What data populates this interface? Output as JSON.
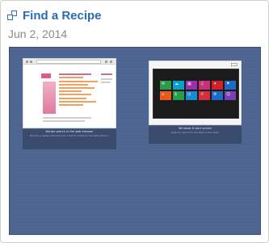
{
  "header": {
    "title": "Find a Recipe",
    "icon": "restore-windows-icon",
    "date": "Jun 2, 2014"
  },
  "stage": {
    "color_background": "#4e6490",
    "windows": [
      {
        "name": "browser-window",
        "caption_title": "Recipe search in the web browser",
        "caption_desc": "Browse a recipe site and pick a dish to make for tonight's dinner."
      },
      {
        "name": "windows8-start-window",
        "caption_title": "Windows 8 start screen",
        "caption_desc": "Open an app from the start screen tiles."
      }
    ],
    "tiles": [
      {
        "color": "#2a9c4a",
        "glyph": "✉"
      },
      {
        "color": "#0aa0d0",
        "glyph": "☁"
      },
      {
        "color": "#9b2fae",
        "glyph": "▦"
      },
      {
        "color": "#c8307a",
        "glyph": "♫"
      },
      {
        "color": "#d0202a",
        "glyph": "✈"
      },
      {
        "color": "#1e6ac8",
        "glyph": "⚑"
      },
      {
        "color": "#e85a1a",
        "glyph": "⌂"
      },
      {
        "color": "#2a9c4a",
        "glyph": "$"
      },
      {
        "color": "#1a8ad0",
        "glyph": "◷"
      },
      {
        "color": "#d03040",
        "glyph": "☼"
      },
      {
        "color": "#1e6ac8",
        "glyph": "⚙"
      },
      {
        "color": "#7a3fb0",
        "glyph": "☺"
      }
    ]
  }
}
